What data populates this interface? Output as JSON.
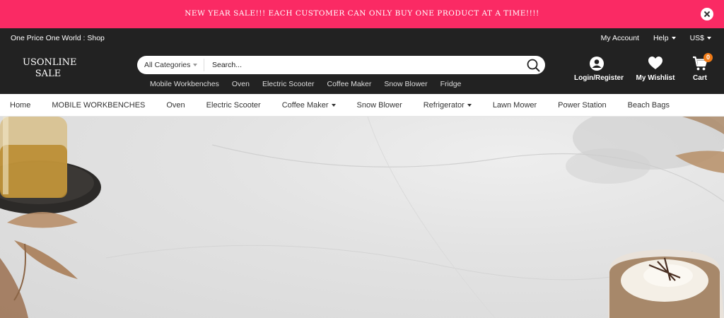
{
  "promo": {
    "text": "NEW YEAR SALE!!! EACH CUSTOMER CAN ONLY BUY ONE PRODUCT AT A TIME!!!!"
  },
  "topbar": {
    "slogan": "One Price One World : Shop",
    "my_account": "My Account",
    "help": "Help",
    "currency": "US$"
  },
  "logo": {
    "line1": "USONLINE",
    "line2": "SALE"
  },
  "search": {
    "category": "All Categories",
    "placeholder": "Search..."
  },
  "quick_links": [
    "Mobile Workbenches",
    "Oven",
    "Electric Scooter",
    "Coffee Maker",
    "Snow Blower",
    "Fridge"
  ],
  "header_icons": {
    "login": "Login/Register",
    "wishlist": "My Wishlist",
    "cart": "Cart",
    "cart_count": "0"
  },
  "nav": [
    "Home",
    "MOBILE WORKBENCHES",
    "Oven",
    "Electric Scooter",
    "Coffee Maker",
    "Snow Blower",
    "Refrigerator",
    "Lawn Mower",
    "Power Station",
    "Beach Bags"
  ],
  "colors": {
    "promo_bg": "#fa2a64",
    "header_bg": "#222222",
    "badge": "#f07b17"
  }
}
